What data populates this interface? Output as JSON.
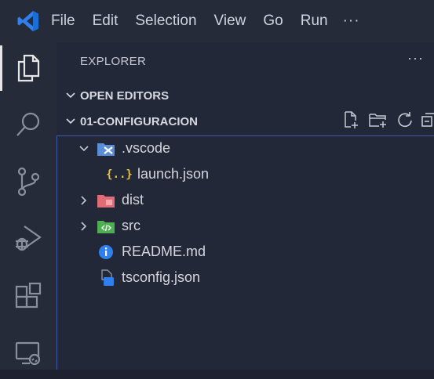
{
  "menu": {
    "items": [
      "File",
      "Edit",
      "Selection",
      "View",
      "Go",
      "Run"
    ],
    "more": "···"
  },
  "activity_bar": {
    "items": [
      {
        "name": "explorer-icon",
        "active": true
      },
      {
        "name": "search-icon",
        "active": false
      },
      {
        "name": "source-control-icon",
        "active": false
      },
      {
        "name": "run-debug-icon",
        "active": false
      },
      {
        "name": "extensions-icon",
        "active": false
      },
      {
        "name": "remote-explorer-icon",
        "active": false
      }
    ]
  },
  "sidebar": {
    "title": "EXPLORER",
    "more": "···",
    "open_editors": "OPEN EDITORS",
    "folder": "01-CONFIGURACION",
    "tree": [
      {
        "label": ".vscode",
        "type": "folder",
        "expanded": true,
        "icon": "vscode-folder-icon"
      },
      {
        "label": "launch.json",
        "type": "file",
        "icon": "json-file-icon",
        "glyph": "{..}"
      },
      {
        "label": "dist",
        "type": "folder",
        "expanded": false,
        "icon": "dist-folder-icon"
      },
      {
        "label": "src",
        "type": "folder",
        "expanded": false,
        "icon": "src-folder-icon"
      },
      {
        "label": "README.md",
        "type": "file",
        "icon": "info-file-icon"
      },
      {
        "label": "tsconfig.json",
        "type": "file",
        "icon": "typescript-config-icon",
        "glyph": "TS"
      }
    ]
  },
  "colors": {
    "accent_blue": "#2f80ed",
    "json_yellow": "#e8c14a",
    "dist_red": "#e06c75",
    "src_green": "#4caf50",
    "focus_border": "#3b5ba8"
  }
}
